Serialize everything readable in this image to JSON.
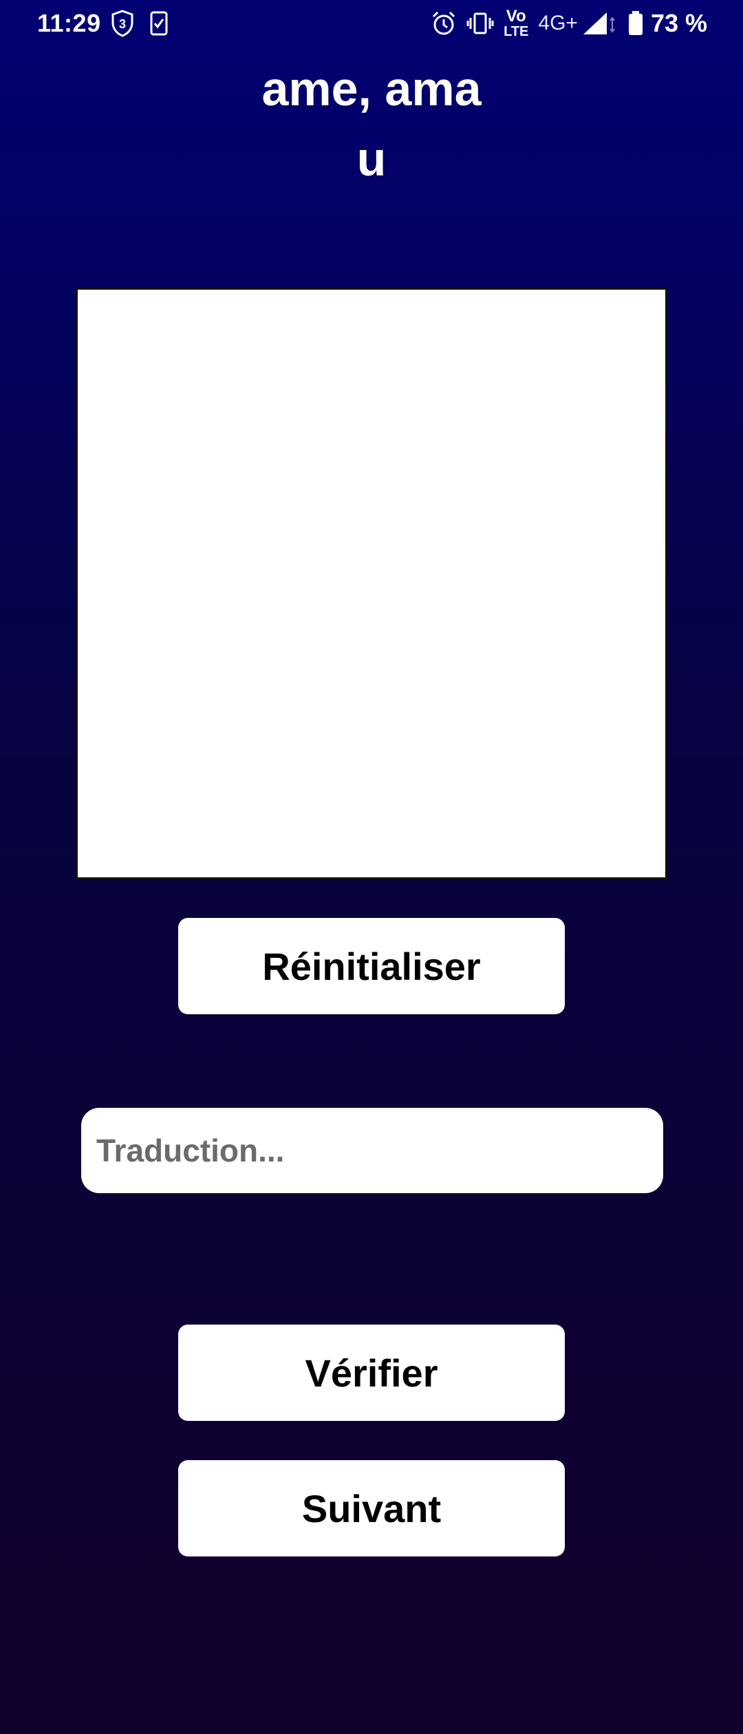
{
  "status_bar": {
    "time": "11:29",
    "notification_count": "3",
    "network_label_top": "Vo",
    "network_label_bottom": "LTE",
    "network_type": "4G+",
    "battery_percent": "73 %",
    "icons": [
      "shield-badge-icon",
      "task-check-icon",
      "alarm-icon",
      "vibrate-icon",
      "volte-icon",
      "signal-icon",
      "battery-icon"
    ]
  },
  "word": {
    "line1": "ame, ama",
    "line2": "u"
  },
  "canvas": {
    "background": "#ffffff"
  },
  "buttons": {
    "reset": "Réinitialiser",
    "verify": "Vérifier",
    "next": "Suivant"
  },
  "translation": {
    "placeholder": "Traduction...",
    "value": ""
  },
  "colors": {
    "background_top": "#010173",
    "background_bottom": "#11002b",
    "button_bg": "#ffffff",
    "button_text": "#000000"
  }
}
